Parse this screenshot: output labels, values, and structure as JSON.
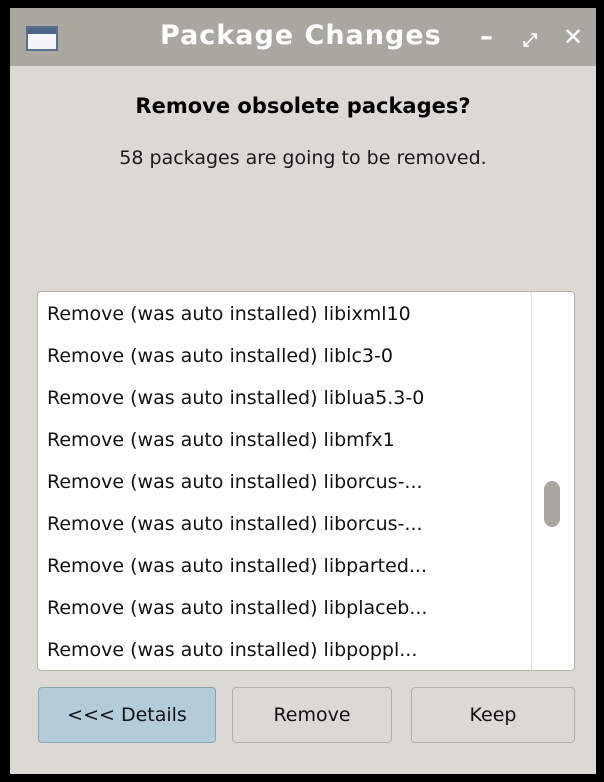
{
  "window": {
    "title": "Package Changes",
    "controls": {
      "minimize": "–",
      "maximize": "⤢",
      "close": "✕"
    }
  },
  "dialog": {
    "heading": "Remove obsolete packages?",
    "subtext": "58 packages are going to be removed."
  },
  "packages": [
    "Remove (was auto installed) libixml10",
    "Remove (was auto installed) liblc3-0",
    "Remove (was auto installed) liblua5.3-0",
    "Remove (was auto installed) libmfx1",
    "Remove (was auto installed) liborcus-...",
    "Remove (was auto installed) liborcus-...",
    "Remove (was auto installed) libparted...",
    "Remove (was auto installed) libplaceb...",
    "Remove (was auto installed) libpoppl..."
  ],
  "buttons": {
    "details": "<<< Details",
    "remove": "Remove",
    "keep": "Keep"
  },
  "colors": {
    "titlebar": "#aaa6a0",
    "window_bg": "#dcd9d5",
    "details_active": "#b3ccd9"
  }
}
